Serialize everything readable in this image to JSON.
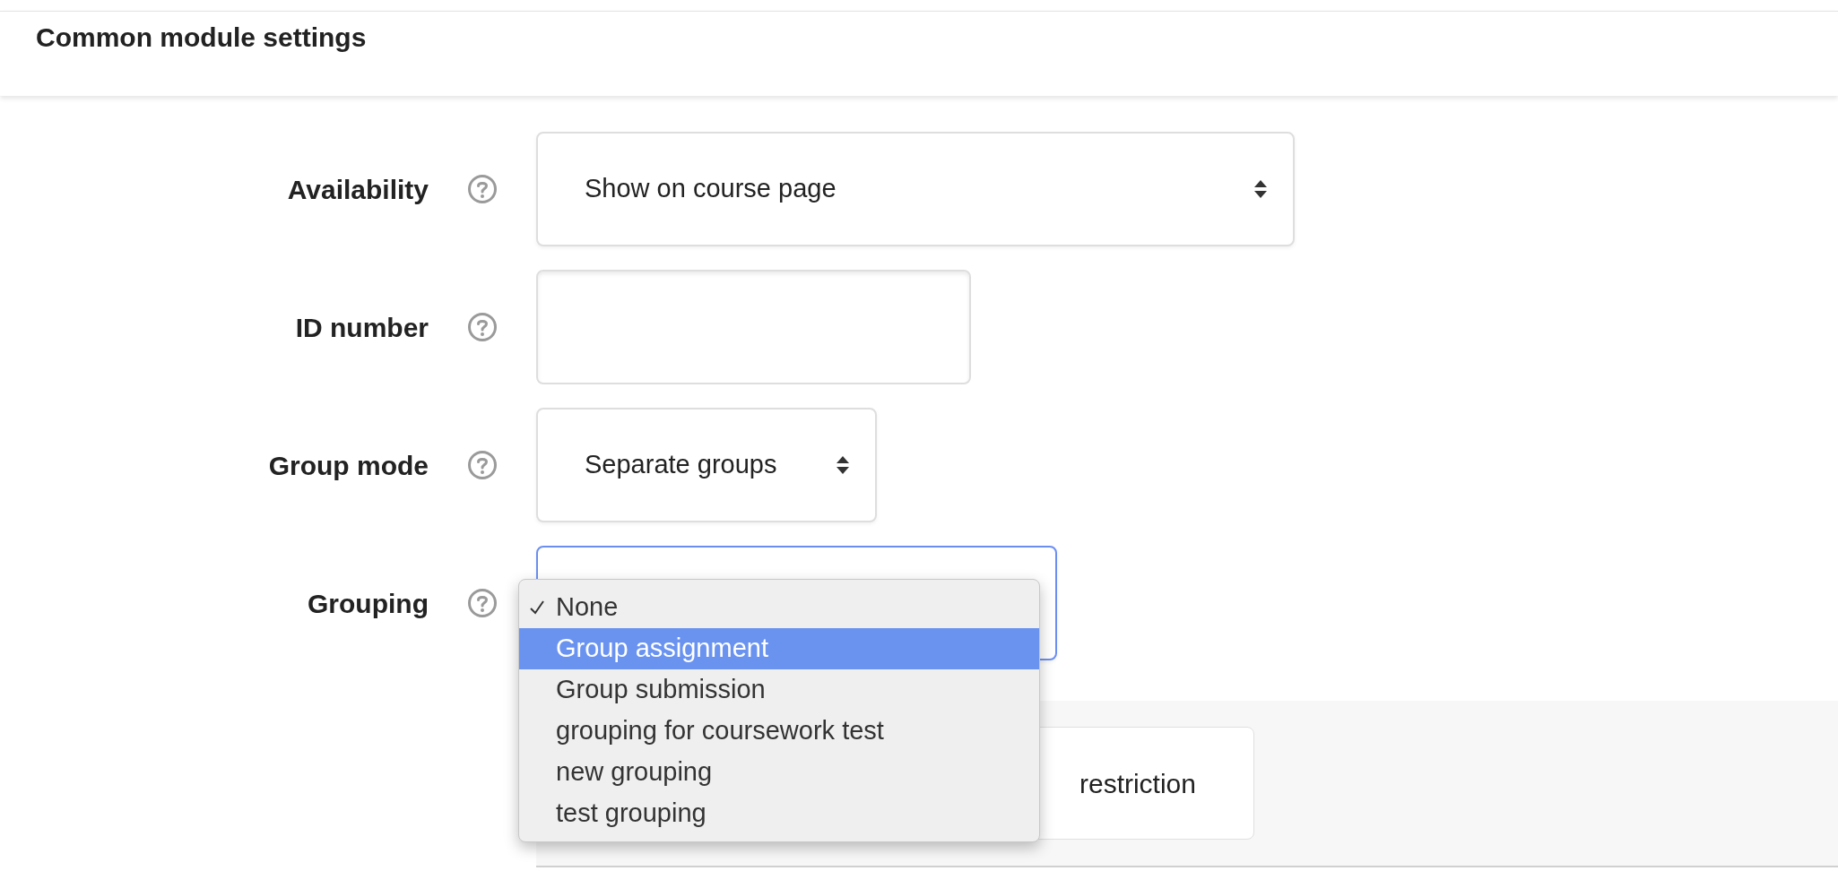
{
  "section": {
    "title": "Common module settings"
  },
  "fields": [
    {
      "label": "Availability",
      "kind": "select",
      "value": "Show on course page",
      "focused": false
    },
    {
      "label": "ID number",
      "kind": "text",
      "focused": false
    },
    {
      "label": "Group mode",
      "kind": "select",
      "value": "Separate groups",
      "focused": false
    },
    {
      "label": "Grouping",
      "kind": "select",
      "focused": true
    }
  ],
  "dropdown": {
    "options": [
      {
        "label": "None",
        "checked": true,
        "selected": false
      },
      {
        "label": "Group assignment",
        "checked": false,
        "selected": true
      },
      {
        "label": "Group submission",
        "checked": false,
        "selected": false
      },
      {
        "label": "grouping for coursework test",
        "checked": false,
        "selected": false
      },
      {
        "label": "new grouping",
        "checked": false,
        "selected": false
      },
      {
        "label": "test grouping",
        "checked": false,
        "selected": false
      }
    ]
  },
  "restriction_button": {
    "label": "restriction"
  }
}
